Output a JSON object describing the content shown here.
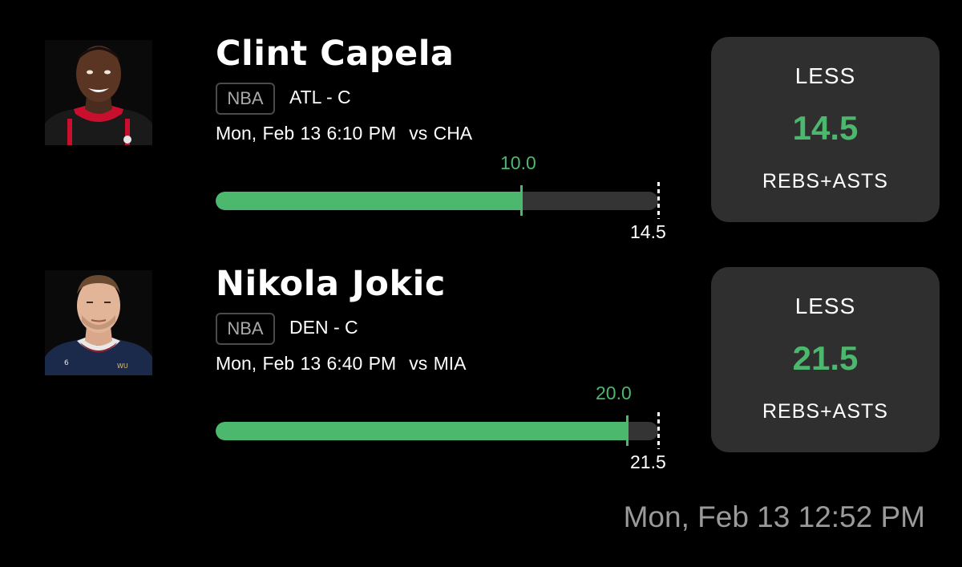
{
  "picks": [
    {
      "player": "Clint Capela",
      "league": "NBA",
      "team_position": "ATL - C",
      "game_date": "Mon, Feb 13 6:10 PM",
      "opponent": "vs CHA",
      "current_value": "10.0",
      "current_value_num": 10.0,
      "line_label": "14.5",
      "line_num": 14.5,
      "pick": {
        "direction": "LESS",
        "line": "14.5",
        "stat": "REBS+ASTS"
      },
      "headshot_icon": "player-headshot-photo",
      "jersey_color": "#1a1a1a",
      "jersey_trim": "#c8102e"
    },
    {
      "player": "Nikola Jokic",
      "league": "NBA",
      "team_position": "DEN - C",
      "game_date": "Mon, Feb 13 6:40 PM",
      "opponent": "vs MIA",
      "current_value": "20.0",
      "current_value_num": 20.0,
      "line_label": "21.5",
      "line_num": 21.5,
      "pick": {
        "direction": "LESS",
        "line": "21.5",
        "stat": "REBS+ASTS"
      },
      "headshot_icon": "player-headshot-photo",
      "jersey_color": "#1b2a4a",
      "jersey_trim": "#8b2131"
    }
  ],
  "timestamp": "Mon, Feb 13 12:52 PM",
  "colors": {
    "accent_green": "#4cb86e",
    "background": "#000000",
    "card": "#2f2f2f",
    "track": "#343434"
  }
}
